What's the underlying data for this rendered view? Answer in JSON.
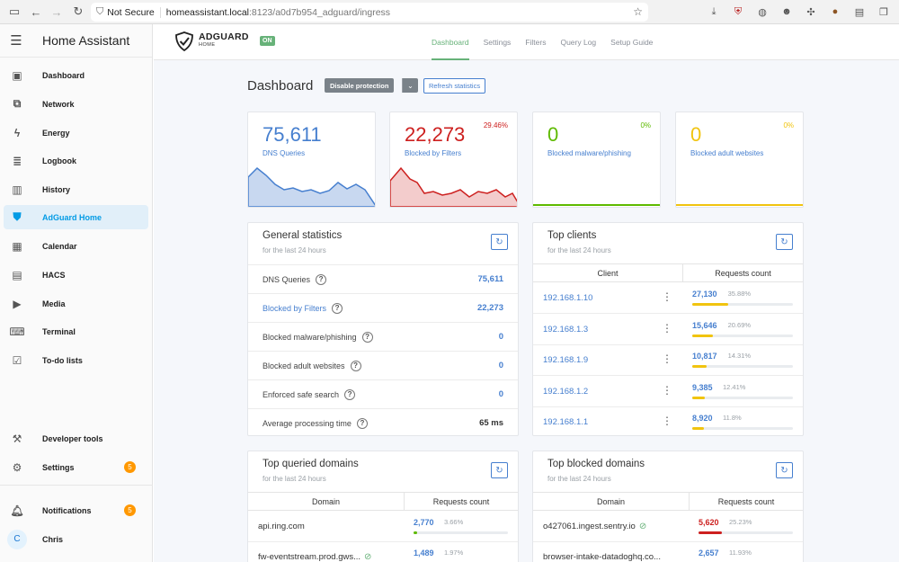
{
  "browser": {
    "not_secure": "Not Secure",
    "url_host": "homeassistant.local",
    "url_path": ":8123/a0d7b954_adguard/ingress"
  },
  "sidebar": {
    "title": "Home Assistant",
    "items": [
      {
        "label": "Dashboard",
        "icon": "dashboard-icon"
      },
      {
        "label": "Network",
        "icon": "network-icon"
      },
      {
        "label": "Energy",
        "icon": "lightning-icon"
      },
      {
        "label": "Logbook",
        "icon": "list-icon"
      },
      {
        "label": "History",
        "icon": "chart-icon"
      },
      {
        "label": "AdGuard Home",
        "icon": "shield-icon"
      },
      {
        "label": "Calendar",
        "icon": "calendar-icon"
      },
      {
        "label": "HACS",
        "icon": "hacs-icon"
      },
      {
        "label": "Media",
        "icon": "media-icon"
      },
      {
        "label": "Terminal",
        "icon": "terminal-icon"
      },
      {
        "label": "To-do lists",
        "icon": "clipboard-icon"
      }
    ],
    "developer_tools": "Developer tools",
    "settings": "Settings",
    "settings_badge": "5",
    "notifications": "Notifications",
    "notifications_badge": "5",
    "user_initial": "C",
    "user_name": "Chris"
  },
  "adguard": {
    "brand": "ADGUARD",
    "brand_sub": "HOME",
    "status": "ON",
    "nav": [
      "Dashboard",
      "Settings",
      "Filters",
      "Query Log",
      "Setup Guide"
    ],
    "page_title": "Dashboard",
    "disable_btn": "Disable protection",
    "refresh_btn": "Refresh statistics",
    "stats": [
      {
        "value": "75,611",
        "label": "DNS Queries",
        "pct": "",
        "color": "#467fcf"
      },
      {
        "value": "22,273",
        "label": "Blocked by Filters",
        "pct": "29.46%",
        "color": "#cd201f"
      },
      {
        "value": "0",
        "label": "Blocked malware/phishing",
        "pct": "0%",
        "color": "#5eba00"
      },
      {
        "value": "0",
        "label": "Blocked adult websites",
        "pct": "0%",
        "color": "#f1c40f"
      }
    ],
    "general": {
      "title": "General statistics",
      "subtitle": "for the last 24 hours",
      "rows": [
        {
          "key": "DNS Queries",
          "value": "75,611"
        },
        {
          "key": "Blocked by Filters",
          "value": "22,273"
        },
        {
          "key": "Blocked malware/phishing",
          "value": "0"
        },
        {
          "key": "Blocked adult websites",
          "value": "0"
        },
        {
          "key": "Enforced safe search",
          "value": "0"
        },
        {
          "key": "Average processing time",
          "value": "65 ms"
        }
      ]
    },
    "clients": {
      "title": "Top clients",
      "subtitle": "for the last 24 hours",
      "col1": "Client",
      "col2": "Requests count",
      "rows": [
        {
          "ip": "192.168.1.10",
          "count": "27,130",
          "pct": "35.88%",
          "fill": 0.359
        },
        {
          "ip": "192.168.1.3",
          "count": "15,646",
          "pct": "20.69%",
          "fill": 0.207
        },
        {
          "ip": "192.168.1.9",
          "count": "10,817",
          "pct": "14.31%",
          "fill": 0.143
        },
        {
          "ip": "192.168.1.2",
          "count": "9,385",
          "pct": "12.41%",
          "fill": 0.124
        },
        {
          "ip": "192.168.1.1",
          "count": "8,920",
          "pct": "11.8%",
          "fill": 0.118
        }
      ]
    },
    "queried": {
      "title": "Top queried domains",
      "subtitle": "for the last 24 hours",
      "col1": "Domain",
      "col2": "Requests count",
      "rows": [
        {
          "domain": "api.ring.com",
          "count": "2,770",
          "pct": "3.66%",
          "fill": 0.037
        },
        {
          "domain": "fw-eventstream.prod.gws...",
          "count": "1,489",
          "pct": "1.97%",
          "fill": 0.02
        }
      ]
    },
    "blocked": {
      "title": "Top blocked domains",
      "subtitle": "for the last 24 hours",
      "col1": "Domain",
      "col2": "Requests count",
      "rows": [
        {
          "domain": "o427061.ingest.sentry.io",
          "count": "5,620",
          "pct": "25.23%",
          "fill": 0.252
        },
        {
          "domain": "browser-intake-datadoghq.co...",
          "count": "2,657",
          "pct": "11.93%",
          "fill": 0.119
        }
      ]
    }
  }
}
